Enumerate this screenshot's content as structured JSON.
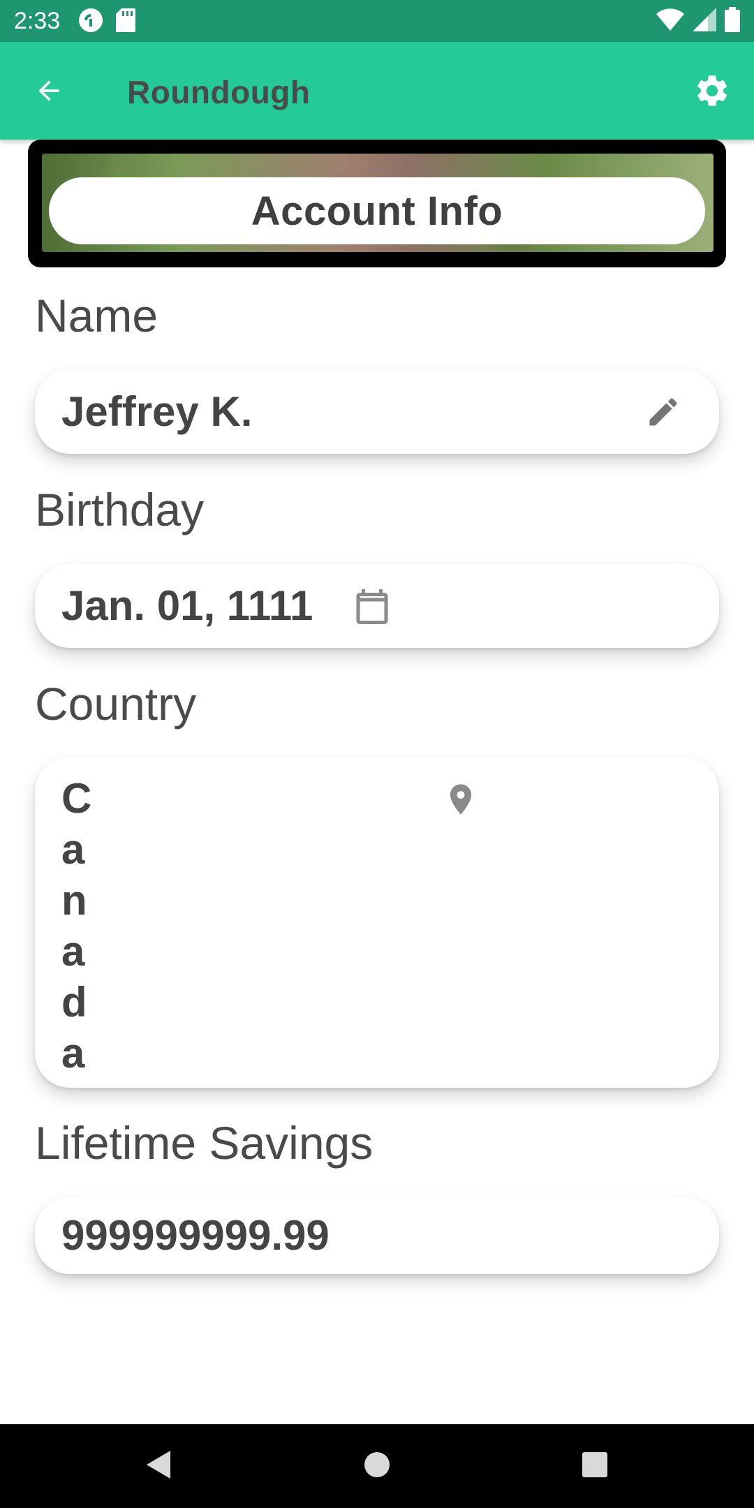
{
  "status_bar": {
    "time": "2:33",
    "icons": [
      "pocket-casts-icon",
      "sd-card-icon",
      "wifi-icon",
      "signal-icon",
      "battery-icon"
    ]
  },
  "app_bar": {
    "title": "Roundough",
    "back_icon": "arrow-left-icon",
    "settings_icon": "gear-icon",
    "background_color": "#24cb97"
  },
  "banner": {
    "title": "Account Info"
  },
  "fields": {
    "name": {
      "label": "Name",
      "value": "Jeffrey K.",
      "icon": "pencil-icon"
    },
    "birthday": {
      "label": "Birthday",
      "value": "Jan. 01, 1111",
      "icon": "calendar-icon"
    },
    "country": {
      "label": "Country",
      "value": "Canada",
      "icon": "map-pin-icon"
    },
    "lifetime_savings": {
      "label": "Lifetime Savings",
      "value": "999999999.99"
    }
  },
  "nav_bar": {
    "back_icon": "triangle-back-icon",
    "home_icon": "circle-home-icon",
    "recents_icon": "square-recents-icon"
  }
}
